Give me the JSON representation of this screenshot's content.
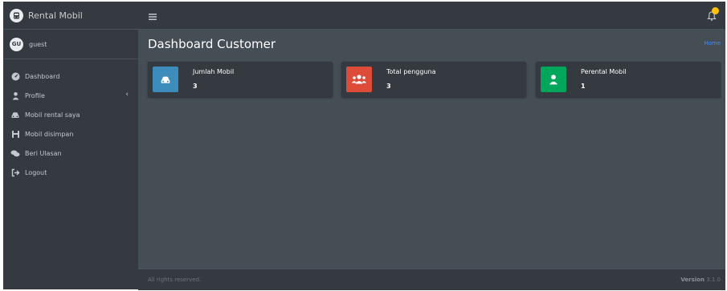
{
  "brand": {
    "title": "Rental Mobil"
  },
  "user": {
    "initials": "GU",
    "name": "guest"
  },
  "nav": [
    {
      "label": "Dashboard",
      "icon": "dashboard-icon"
    },
    {
      "label": "Profile",
      "icon": "user-icon",
      "submenu": true
    },
    {
      "label": "Mobil rental saya",
      "icon": "car-icon"
    },
    {
      "label": "Mobil disimpan",
      "icon": "save-icon"
    },
    {
      "label": "Beri Ulasan",
      "icon": "comments-icon"
    },
    {
      "label": "Logout",
      "icon": "sign-out-icon"
    }
  ],
  "header": {
    "page_title": "Dashboard Customer",
    "breadcrumb": "Home"
  },
  "info_boxes": [
    {
      "label": "Jumlah Mobil",
      "value": "3",
      "color": "#3c8dbc",
      "icon": "car-icon"
    },
    {
      "label": "Total pengguna",
      "value": "3",
      "color": "#dd4b39",
      "icon": "users-icon"
    },
    {
      "label": "Perental Mobil",
      "value": "1",
      "color": "#00a65a",
      "icon": "user-icon"
    }
  ],
  "footer": {
    "text": "All rights reserved.",
    "version_label": "Version",
    "version": "3.1.0"
  },
  "colors": {
    "sidebar": "#343a40",
    "content": "#454d55",
    "accent_link": "#3f8efc",
    "notification_badge": "#ffc107"
  }
}
